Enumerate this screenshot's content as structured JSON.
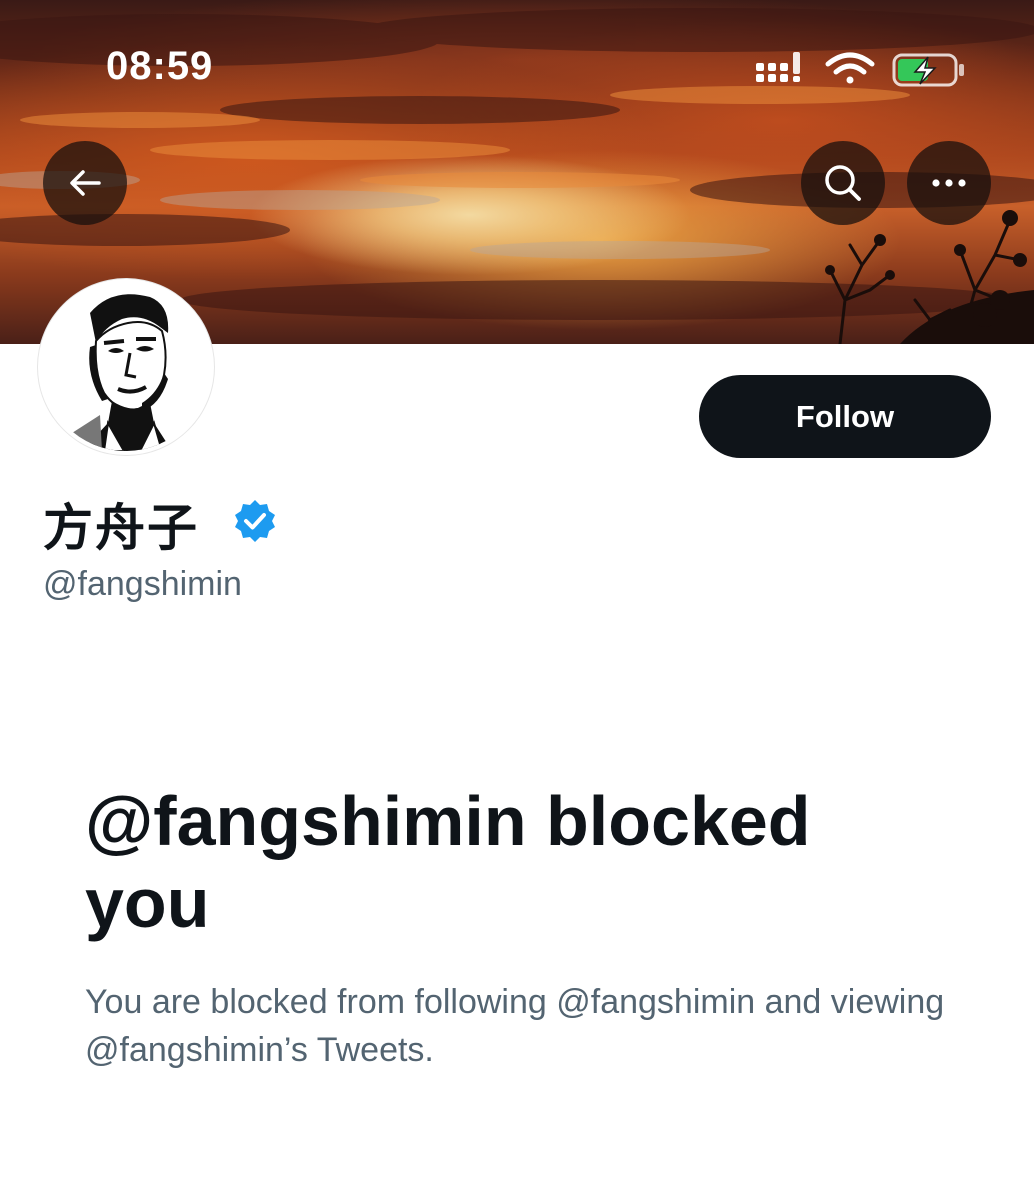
{
  "status_bar": {
    "time": "08:59",
    "icons": [
      "cellular-signal-icon",
      "wifi-icon",
      "battery-charging-icon"
    ],
    "battery_color": "#34c759"
  },
  "header": {
    "back_icon": "arrow-left-icon",
    "search_icon": "search-icon",
    "more_icon": "more-horizontal-icon"
  },
  "profile": {
    "display_name": "方舟子",
    "verified": true,
    "verified_color": "#1d9bf0",
    "handle": "@fangshimin",
    "follow_label": "Follow"
  },
  "blocked_notice": {
    "heading": "@fangshimin blocked you",
    "description": "You are blocked from following @fangshimin and viewing @fangshimin’s Tweets."
  }
}
